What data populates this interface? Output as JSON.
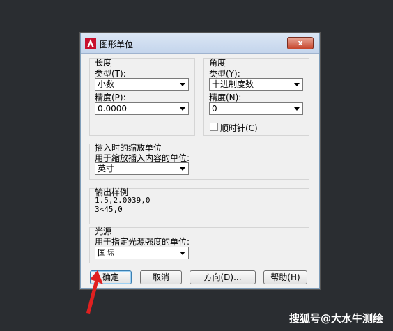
{
  "window": {
    "title": "图形单位",
    "close_label": "x"
  },
  "length": {
    "group_title": "长度",
    "type_label": "类型(T):",
    "type_value": "小数",
    "precision_label": "精度(P):",
    "precision_value": "0.0000"
  },
  "angle": {
    "group_title": "角度",
    "type_label": "类型(Y):",
    "type_value": "十进制度数",
    "precision_label": "精度(N):",
    "precision_value": "0",
    "clockwise_label": "顺时针(C)",
    "clockwise_checked": false
  },
  "insertion": {
    "group_title": "插入时的缩放单位",
    "desc": "用于缩放插入内容的单位:",
    "value": "英寸"
  },
  "sample": {
    "group_title": "输出样例",
    "line1": "1.5,2.0039,0",
    "line2": "3<45,0"
  },
  "lighting": {
    "group_title": "光源",
    "desc": "用于指定光源强度的单位:",
    "value": "国际"
  },
  "buttons": {
    "ok": "确定",
    "cancel": "取消",
    "direction": "方向(D)...",
    "help": "帮助(H)"
  },
  "watermark": "搜狐号@大水牛测绘",
  "colors": {
    "background": "#2a2d31",
    "arrow": "#e02020",
    "app_icon": "#c8102e"
  }
}
